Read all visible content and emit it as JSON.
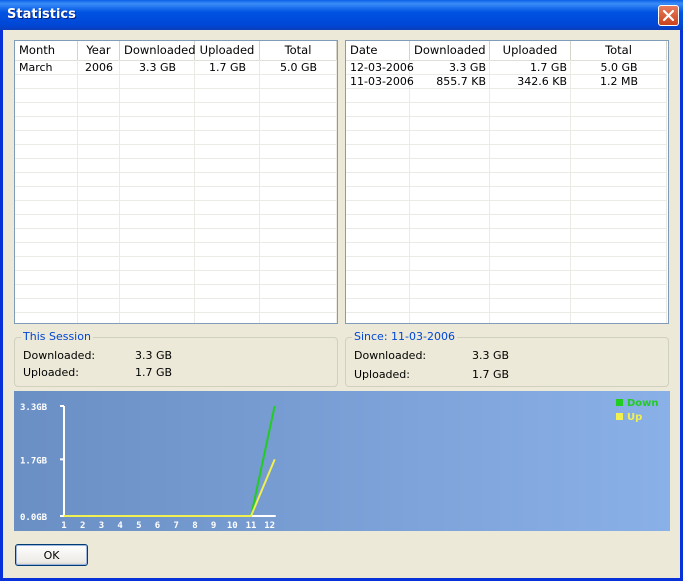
{
  "window": {
    "title": "Statistics"
  },
  "monthly": {
    "columns": [
      "Month",
      "Year",
      "Downloaded",
      "Uploaded",
      "Total"
    ],
    "rows": [
      [
        "March",
        "2006",
        "3.3 GB",
        "1.7 GB",
        "5.0 GB"
      ]
    ]
  },
  "daily": {
    "columns": [
      "Date",
      "Downloaded",
      "Uploaded",
      "Total"
    ],
    "rows": [
      [
        "12-03-2006",
        "3.3 GB",
        "1.7 GB",
        "5.0 GB"
      ],
      [
        "11-03-2006",
        "855.7 KB",
        "342.6 KB",
        "1.2 MB"
      ]
    ]
  },
  "this_session": {
    "legend": "This Session",
    "downloaded_label": "Downloaded:",
    "downloaded_value": "3.3  GB",
    "uploaded_label": "Uploaded:",
    "uploaded_value": "1.7  GB"
  },
  "since": {
    "legend": "Since: 11-03-2006",
    "downloaded_label": "Downloaded:",
    "downloaded_value": "3.3 GB",
    "uploaded_label": "Uploaded:",
    "uploaded_value": "1.7 GB"
  },
  "chart_data": {
    "type": "line",
    "x": [
      1,
      2,
      3,
      4,
      5,
      6,
      7,
      8,
      9,
      10,
      11,
      12
    ],
    "x_tick_labels": [
      "1",
      "2",
      "3",
      "4",
      "5",
      "6",
      "7",
      "8",
      "9",
      "10",
      "11",
      "12"
    ],
    "y_tick_labels": [
      "3.3GB",
      "1.7GB",
      "0.0GB"
    ],
    "y_tick_values": [
      3.3,
      1.7,
      0.0
    ],
    "ylim": [
      0,
      3.3
    ],
    "series": [
      {
        "name": "Down",
        "color": "#22cc22",
        "values": [
          0,
          0,
          0,
          0,
          0,
          0,
          0,
          0,
          0,
          0,
          0,
          3.3
        ]
      },
      {
        "name": "Up",
        "color": "#f0f050",
        "values": [
          0,
          0,
          0,
          0,
          0,
          0,
          0,
          0,
          0,
          0,
          0,
          1.7
        ]
      }
    ],
    "legend_position": "top-right",
    "axis_color": "#ffffff"
  },
  "buttons": {
    "ok": "OK"
  }
}
